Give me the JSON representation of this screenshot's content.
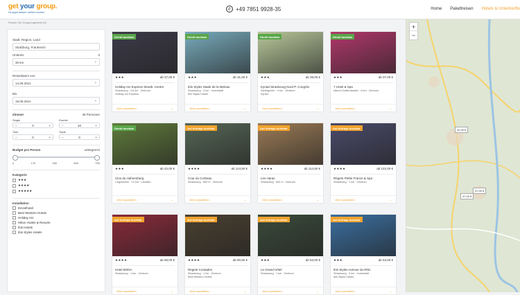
{
  "header": {
    "logo_main_a": "get ",
    "logo_main_b": "your",
    "logo_main_c": " group.",
    "logo_sub": "Gruppenreisen online buchen",
    "phone": "+49 7851 9928-35",
    "nav": [
      "Home",
      "Pakettreisen",
      "Hotels & Unterkünfte"
    ]
  },
  "breadcrumb": "Finden Sie Gruppengebiete (0)",
  "filters": {
    "location_label": "Stadt, Region, Land",
    "location_value": "Straßburg, Frankreich",
    "radius_label": "Umkreis",
    "radius_hint": "0",
    "radius_value": "30 km",
    "arrival_label": "Reisedatum von",
    "arrival_value": "14.09.2021",
    "departure_label": "Bis",
    "departure_value": "18.09.2021",
    "rooms_label": "Zimmer",
    "persons_label": "48 Personen",
    "rooms": [
      {
        "label": "Single",
        "value": "0",
        "minus": "−",
        "plus": "+"
      },
      {
        "label": "Double",
        "value": "10",
        "minus": "−",
        "plus": "+"
      },
      {
        "label": "Twin",
        "value": "0",
        "minus": "−",
        "plus": "+"
      },
      {
        "label": "Triple",
        "value": "0",
        "minus": "−",
        "plus": "+"
      }
    ],
    "budget_label": "Budget pro Person",
    "budget_limit": "unbegrenzt",
    "budget_ticks": [
      "0",
      "179",
      "330",
      "820",
      "750"
    ],
    "category_label": "Kategorie",
    "categories": [
      "★★★",
      "★★★★",
      "★★★★★"
    ],
    "facilities_label": "Installation",
    "facilities": [
      "Einzelhotel",
      "Best Western Hotels",
      "Holiday Inn",
      "Hilton Hotels & Resorts",
      "Ibis Hotels",
      "Ibis Styles Hotels"
    ]
  },
  "hotels": [
    {
      "badge": "Direkt buchbar",
      "badge_type": "green",
      "stars": "★★★",
      "price": "ab 37,00 €",
      "name": "Holiday Inn Express Strasb. Centre",
      "meta": "Strasbourg · 0,5 km · Zentrum",
      "chain": "Holiday Inn Express",
      "cta": "Jetzt auswählen",
      "photo": "#3c3a48"
    },
    {
      "badge": "Direkt buchbar",
      "badge_type": "green",
      "stars": "★★★",
      "price": "ab 31,00 €",
      "name": "Ibis Styles Stade de la Meinau",
      "meta": "Strasbourg · 3 km · Innenstadt",
      "chain": "Ibis Styles Hotels",
      "cta": "Jetzt auswählen",
      "photo": "#77aabb"
    },
    {
      "badge": "Direkt buchbar",
      "badge_type": "green",
      "stars": "★★★",
      "price": "ab 39,00 €",
      "name": "Kyriad Strasbourg Nord P. Congrès",
      "meta": "Schiltigheim · 4 km · Zentrum",
      "chain": "Kyriad",
      "cta": "Jetzt auswählen",
      "photo": "#b7c79a"
    },
    {
      "badge": "Direkt buchbar",
      "badge_type": "green",
      "stars": "★★★",
      "price": "ab 37,00 €",
      "name": "7 Hotel & Spa",
      "meta": "Illkirch-Graffenstaden · 6 km · Zentrum",
      "chain": "",
      "cta": "Jetzt auswählen",
      "photo": "#b0386a"
    },
    {
      "badge": "Direkt buchbar",
      "badge_type": "green",
      "stars": "★★★",
      "price": "ab 42,00 €",
      "name": "Clos du Hahnenberg",
      "meta": "Lingolsheim · 12 km · Ländlich",
      "chain": "",
      "cta": "Jetzt auswählen",
      "photo": "#5f7a3b"
    },
    {
      "badge": "Auf Anfrage buchbar",
      "badge_type": "orange",
      "stars": "★★★★",
      "price": "ab 114,50 €",
      "name": "Cour du Corbeau",
      "meta": "Strasbourg · 650 m · Zentrum",
      "chain": "",
      "cta": "Jetzt auswählen",
      "photo": "#556655"
    },
    {
      "badge": "Auf Anfrage buchbar",
      "badge_type": "orange",
      "stars": "★★★★",
      "price": "ab 114,50 €",
      "name": "Les Haras",
      "meta": "Strasbourg · 600 m · Zentrum",
      "chain": "",
      "cta": "Jetzt auswählen",
      "photo": "#9a7a55"
    },
    {
      "badge": "Auf Anfrage buchbar",
      "badge_type": "orange",
      "stars": "★★★★",
      "price": "ab 122,00 €",
      "name": "Régent Petite France & Spa",
      "meta": "Strasbourg · 1 km · Zentrum",
      "chain": "",
      "cta": "Jetzt auswählen",
      "photo": "#4a4a6a"
    },
    {
      "badge": "Auf Anfrage buchbar",
      "badge_type": "orange",
      "stars": "★★★★",
      "price": "ab 68,00 €",
      "name": "Hotel BONA",
      "meta": "Strasbourg · 1 km · Zentrum",
      "chain": "",
      "cta": "Jetzt auswählen",
      "photo": "#8a2a3a"
    },
    {
      "badge": "Auf Anfrage buchbar",
      "badge_type": "orange",
      "stars": "★★★★",
      "price": "ab 80,50 €",
      "name": "Regent Contades",
      "meta": "Strasbourg · 1 km · Zentrum",
      "chain": "Best Western Hotels",
      "cta": "Jetzt auswählen",
      "photo": "#4a4030"
    },
    {
      "badge": "Auf Anfrage buchbar",
      "badge_type": "orange",
      "stars": "★★★",
      "price": "ab 53,00 €",
      "name": "Le Grand Hôtel",
      "meta": "Strasbourg · 1 km · Zentrum",
      "chain": "",
      "cta": "Jetzt auswählen",
      "photo": "#3a4a3a"
    },
    {
      "badge": "Auf Anfrage buchbar",
      "badge_type": "orange",
      "stars": "★★★",
      "price": "ab 53,00 €",
      "name": "Ibis Styles Avenue du Rhin",
      "meta": "Strasbourg · 3 km · Innenstadt",
      "chain": "Ibis Styles Hotels",
      "cta": "Jetzt auswählen",
      "photo": "#3b6fa0"
    }
  ],
  "map": {
    "zoom_in": "+",
    "zoom_out": "−",
    "pins": [
      "42,00 €",
      "37,00 €",
      "37,00 €"
    ]
  }
}
